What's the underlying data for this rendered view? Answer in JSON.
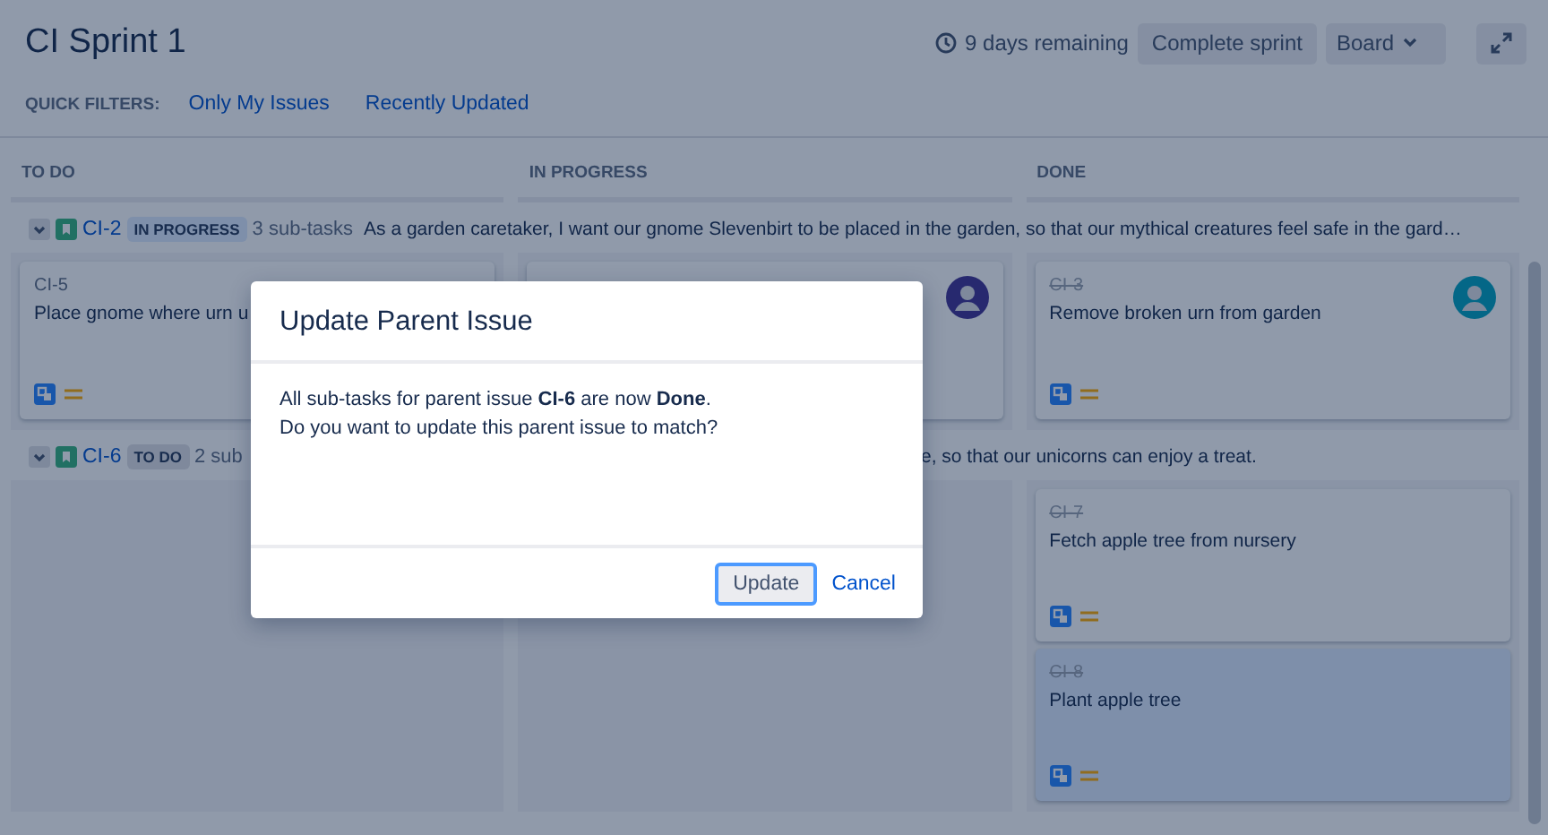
{
  "header": {
    "title": "CI Sprint 1",
    "remaining": "9 days remaining",
    "complete_button": "Complete sprint",
    "board_button": "Board"
  },
  "quick_filters": {
    "label": "QUICK FILTERS:",
    "filters": [
      "Only My Issues",
      "Recently Updated"
    ]
  },
  "columns": [
    "TO DO",
    "IN PROGRESS",
    "DONE"
  ],
  "swimlanes": [
    {
      "expanded": true,
      "key": "CI-2",
      "status": "IN PROGRESS",
      "color": "#7e8faa",
      "subtasks": "3 sub-tasks",
      "summary": "As a garden caretaker, I want our gnome Slevenbirt to be placed in the garden, so that our mythical creatures feel safe in the gard…",
      "cells": [
        [
          {
            "key": "CI-5",
            "title": "Place gnome where urn u",
            "done": false,
            "selected": false
          }
        ],
        [
          {
            "avatar": true,
            "color": "#27296f",
            "selected": false
          }
        ],
        [
          {
            "key": "CI-3",
            "title": "Remove broken urn from garden",
            "done": true,
            "selected": false,
            "avatar": true,
            "color": "#046787"
          }
        ]
      ]
    },
    {
      "expanded": true,
      "key": "CI-6",
      "status": "TO DO",
      "color": "#7f899c",
      "subtasks": "2 sub",
      "summary_tail": "e, so that our unicorns can enjoy a treat.",
      "cells": [
        [],
        [],
        [
          {
            "key": "CI-7",
            "title": "Fetch apple tree from nursery",
            "done": true,
            "selected": false
          },
          {
            "key": "CI-8",
            "title": "Plant apple tree",
            "done": true,
            "selected": true
          }
        ]
      ]
    }
  ],
  "dialog": {
    "title": "Update Parent Issue",
    "message": "All sub-tasks for parent issue **CI-6** are now **Done**.\nDo you want to update this parent issue to match?",
    "primary": "Update",
    "cancel": "Cancel"
  }
}
